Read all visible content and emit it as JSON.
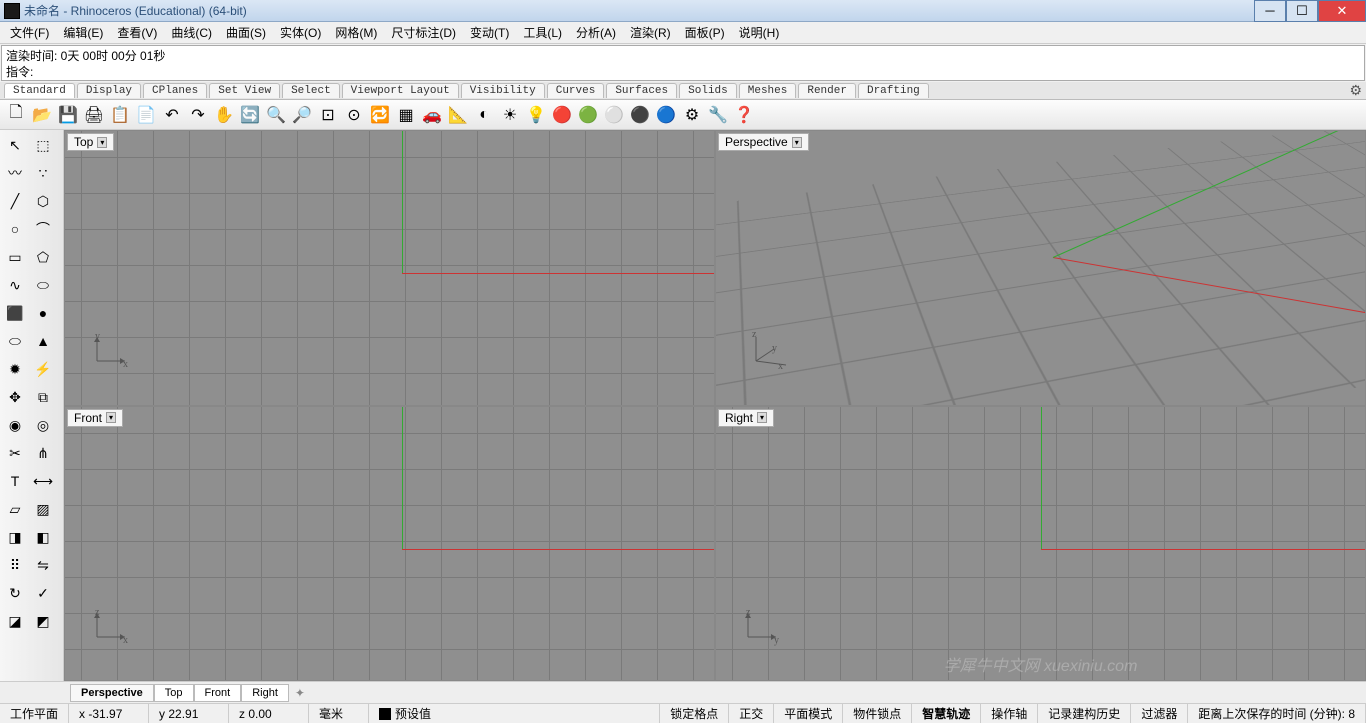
{
  "title": "未命名 - Rhinoceros (Educational) (64-bit)",
  "menu": [
    "文件(F)",
    "编辑(E)",
    "查看(V)",
    "曲线(C)",
    "曲面(S)",
    "实体(O)",
    "网格(M)",
    "尺寸标注(D)",
    "变动(T)",
    "工具(L)",
    "分析(A)",
    "渲染(R)",
    "面板(P)",
    "说明(H)"
  ],
  "cmd": {
    "render_time": "渲染时间: 0天 00时 00分 01秒",
    "prompt": "指令:",
    "value": ""
  },
  "toolbar_tabs": [
    "Standard",
    "Display",
    "CPlanes",
    "Set View",
    "Select",
    "Viewport Layout",
    "Visibility",
    "Curves",
    "Surfaces",
    "Solids",
    "Meshes",
    "Render",
    "Drafting"
  ],
  "main_icons": [
    {
      "n": "new-icon",
      "g": "🗋"
    },
    {
      "n": "open-icon",
      "g": "📂"
    },
    {
      "n": "save-icon",
      "g": "💾"
    },
    {
      "n": "print-icon",
      "g": "🖨"
    },
    {
      "n": "copy-icon",
      "g": "📋"
    },
    {
      "n": "paste-icon",
      "g": "📄"
    },
    {
      "n": "undo-icon",
      "g": "↶"
    },
    {
      "n": "redo-icon",
      "g": "↷"
    },
    {
      "n": "pan-icon",
      "g": "✋"
    },
    {
      "n": "rotate-icon",
      "g": "🔄"
    },
    {
      "n": "zoom-dyn-icon",
      "g": "🔍"
    },
    {
      "n": "zoom-win-icon",
      "g": "🔎"
    },
    {
      "n": "zoom-ext-icon",
      "g": "⊡"
    },
    {
      "n": "zoom-sel-icon",
      "g": "⊙"
    },
    {
      "n": "named-view-icon",
      "g": "🔁"
    },
    {
      "n": "cplane-icon",
      "g": "▦"
    },
    {
      "n": "car-icon",
      "g": "🚗"
    },
    {
      "n": "dim-icon",
      "g": "📐"
    },
    {
      "n": "shade-icon",
      "g": "◐"
    },
    {
      "n": "layers-icon",
      "g": "☀"
    },
    {
      "n": "hide-icon",
      "g": "💡"
    },
    {
      "n": "render-icon",
      "g": "🔴"
    },
    {
      "n": "material-icon",
      "g": "🟢"
    },
    {
      "n": "sphere-gray-icon",
      "g": "⚪"
    },
    {
      "n": "sphere-chrome-icon",
      "g": "⚫"
    },
    {
      "n": "sphere-blue-icon",
      "g": "🔵"
    },
    {
      "n": "options-icon",
      "g": "⚙"
    },
    {
      "n": "properties-icon",
      "g": "🔧"
    },
    {
      "n": "help-icon",
      "g": "❓"
    }
  ],
  "left_icons": [
    {
      "n": "pointer-icon",
      "g": "↖"
    },
    {
      "n": "lasso-icon",
      "g": "⬚"
    },
    {
      "n": "point-icon",
      "g": "〰"
    },
    {
      "n": "points-icon",
      "g": "∵"
    },
    {
      "n": "line-icon",
      "g": "╱"
    },
    {
      "n": "polyline-icon",
      "g": "⬡"
    },
    {
      "n": "circle-icon",
      "g": "○"
    },
    {
      "n": "arc-icon",
      "g": "⌒"
    },
    {
      "n": "rect-icon",
      "g": "▭"
    },
    {
      "n": "polygon-icon",
      "g": "⬠"
    },
    {
      "n": "curve-icon",
      "g": "∿"
    },
    {
      "n": "ellipse-icon",
      "g": "⬭"
    },
    {
      "n": "box-icon",
      "g": "⬛"
    },
    {
      "n": "sphere-icon",
      "g": "●"
    },
    {
      "n": "cylinder-icon",
      "g": "⬭"
    },
    {
      "n": "cone-icon",
      "g": "▲"
    },
    {
      "n": "explode-icon",
      "g": "✹"
    },
    {
      "n": "join-icon",
      "g": "⚡"
    },
    {
      "n": "move-icon",
      "g": "✥"
    },
    {
      "n": "copy-obj-icon",
      "g": "⧉"
    },
    {
      "n": "boolean-icon",
      "g": "◉"
    },
    {
      "n": "boolean2-icon",
      "g": "◎"
    },
    {
      "n": "trim-icon",
      "g": "✂"
    },
    {
      "n": "split-icon",
      "g": "⋔"
    },
    {
      "n": "text-icon",
      "g": "T"
    },
    {
      "n": "dim-left-icon",
      "g": "⟷"
    },
    {
      "n": "surface-icon",
      "g": "▱"
    },
    {
      "n": "mesh-icon",
      "g": "▨"
    },
    {
      "n": "extrude-icon",
      "g": "◨"
    },
    {
      "n": "loft-icon",
      "g": "◧"
    },
    {
      "n": "array-icon",
      "g": "⠿"
    },
    {
      "n": "mirror-icon",
      "g": "⇋"
    },
    {
      "n": "rotate-obj-icon",
      "g": "↻"
    },
    {
      "n": "scale-icon",
      "g": "✓"
    },
    {
      "n": "group-icon",
      "g": "◪"
    },
    {
      "n": "ungroup-icon",
      "g": "◩"
    }
  ],
  "viewports": {
    "top": "Top",
    "perspective": "Perspective",
    "front": "Front",
    "right": "Right",
    "axis_x": "x",
    "axis_y": "y",
    "axis_z": "z"
  },
  "viewtabs": [
    "Perspective",
    "Top",
    "Front",
    "Right"
  ],
  "status": {
    "cplane": "工作平面",
    "x": "x -31.97",
    "y": "y 22.91",
    "z": "z 0.00",
    "units": "毫米",
    "preset": "预设值",
    "gridsnap": "锁定格点",
    "ortho": "正交",
    "planar": "平面模式",
    "osnap": "物件锁点",
    "smarttrack": "智慧轨迹",
    "gumball": "操作轴",
    "history": "记录建构历史",
    "filter": "过滤器",
    "savetime": "距离上次保存的时间 (分钟): 8"
  },
  "watermark": "学犀牛中文网 xuexiniu.com"
}
